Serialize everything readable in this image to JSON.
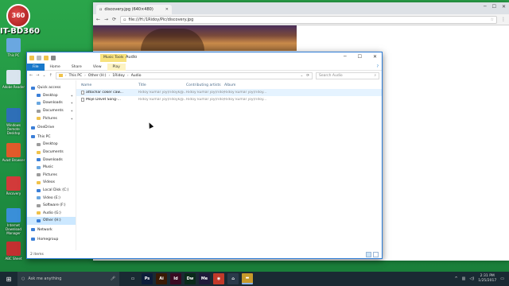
{
  "desktop": {
    "logo_badge": "360",
    "logo_text": "IT-BD360",
    "icons": [
      {
        "label": "This PC"
      },
      {
        "label": "Adobe Reader"
      },
      {
        "label": "Windows Remote Desktop"
      },
      {
        "label": "Avast Browser"
      },
      {
        "label": "Recovery"
      },
      {
        "label": "Internet Download Manager"
      },
      {
        "label": "ABC Sheet"
      }
    ]
  },
  "browser": {
    "tab_title": "discovery.jpg (640×480)",
    "url": "file:///H:/1Ridoy/Pic/discovery.jpg"
  },
  "explorer": {
    "window_title": "Audio",
    "context_tab": "Music Tools",
    "ribbon_tabs": [
      "File",
      "Home",
      "Share",
      "View",
      "Play"
    ],
    "address": [
      "This PC",
      "Other (H:)",
      "1Ridoy",
      "Audio"
    ],
    "search_placeholder": "Search Audio",
    "columns": [
      "Name",
      "Title",
      "Contributing artists",
      "Album"
    ],
    "files": [
      {
        "name": "attochar coker caw...",
        "title": "Ridoy kumar joy(ridoyk@...",
        "artist": "Ridoy kumar joy(ridoy@...",
        "album": "Ridoy kumar joy(ridoy..."
      },
      {
        "name": "Moje Dilvet Song-...",
        "title": "Ridoy kumar joy(ridoyk@...",
        "artist": "Ridoy kumar joy(ridoy@...",
        "album": "Ridoy kumar joy(ridoy..."
      }
    ],
    "nav": [
      {
        "label": "Quick access",
        "indent": 0
      },
      {
        "label": "Desktop",
        "indent": 1,
        "pinned": true
      },
      {
        "label": "Downloads",
        "indent": 1,
        "pinned": true
      },
      {
        "label": "Documents",
        "indent": 1,
        "pinned": true
      },
      {
        "label": "Pictures",
        "indent": 1,
        "pinned": true
      },
      {
        "label": "OneDrive",
        "indent": 0
      },
      {
        "label": "This PC",
        "indent": 0
      },
      {
        "label": "Desktop",
        "indent": 1
      },
      {
        "label": "Documents",
        "indent": 1
      },
      {
        "label": "Downloads",
        "indent": 1
      },
      {
        "label": "Music",
        "indent": 1
      },
      {
        "label": "Pictures",
        "indent": 1
      },
      {
        "label": "Videos",
        "indent": 1
      },
      {
        "label": "Local Disk (C:)",
        "indent": 1
      },
      {
        "label": "Video (E:)",
        "indent": 1
      },
      {
        "label": "Software (F:)",
        "indent": 1
      },
      {
        "label": "Audio (G:)",
        "indent": 1
      },
      {
        "label": "Other (H:)",
        "indent": 1,
        "selected": true
      },
      {
        "label": "Network",
        "indent": 0
      },
      {
        "label": "Homegroup",
        "indent": 0
      }
    ],
    "status": "2 items"
  },
  "taskbar": {
    "search_placeholder": "Ask me anything",
    "apps": [
      "Task View",
      "Photoshop",
      "Illustrator",
      "InDesign",
      "Dreamweaver",
      "Media Encoder",
      "Chrome",
      "Store",
      "File Explorer"
    ],
    "time": "2:31 PM",
    "date": "1/25/2017"
  }
}
